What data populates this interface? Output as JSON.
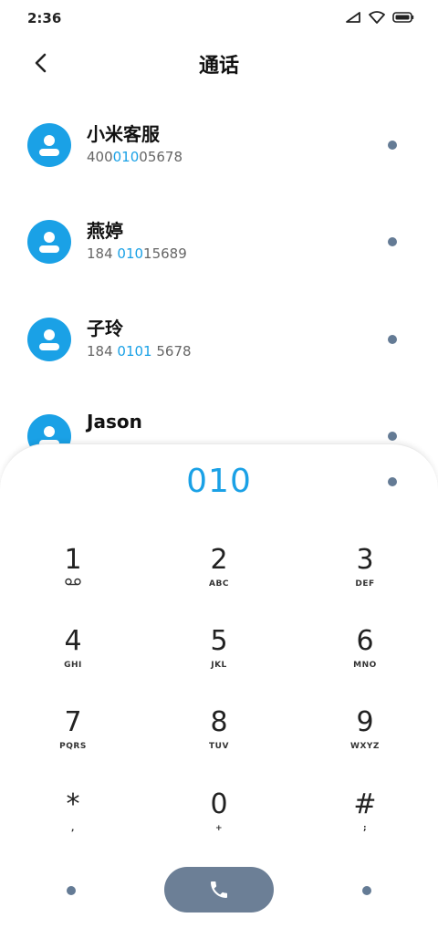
{
  "status_bar": {
    "time": "2:36"
  },
  "header": {
    "title": "通话"
  },
  "contacts": [
    {
      "name": "小米客服",
      "number_parts": [
        "400",
        "010",
        "05678"
      ]
    },
    {
      "name": "燕婷",
      "number_parts": [
        "184 ",
        "010",
        "15689"
      ]
    },
    {
      "name": "子玲",
      "number_parts": [
        "184 ",
        "0101",
        " 5678"
      ]
    },
    {
      "name": "Jason"
    }
  ],
  "dialpad": {
    "dialed": "010",
    "keys": [
      {
        "digit": "1",
        "letters": ""
      },
      {
        "digit": "2",
        "letters": "ABC"
      },
      {
        "digit": "3",
        "letters": "DEF"
      },
      {
        "digit": "4",
        "letters": "GHI"
      },
      {
        "digit": "5",
        "letters": "JKL"
      },
      {
        "digit": "6",
        "letters": "MNO"
      },
      {
        "digit": "7",
        "letters": "PQRS"
      },
      {
        "digit": "8",
        "letters": "TUV"
      },
      {
        "digit": "9",
        "letters": "WXYZ"
      },
      {
        "digit": "*",
        "letters": ","
      },
      {
        "digit": "0",
        "letters": "+"
      },
      {
        "digit": "#",
        "letters": ";"
      }
    ]
  },
  "icons": {
    "back": "chevron-left-icon",
    "avatar": "person-icon",
    "voicemail": "voicemail-icon",
    "call": "phone-icon"
  },
  "colors": {
    "accent": "#1aa1e6",
    "call_button": "#6c7f96",
    "dot": "#647b95"
  }
}
